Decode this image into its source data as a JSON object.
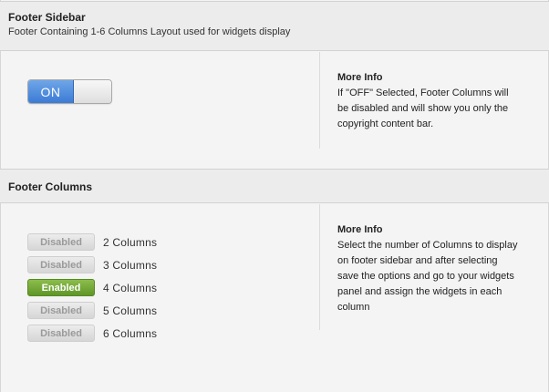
{
  "footer_sidebar": {
    "title": "Footer Sidebar",
    "subtitle": "Footer Containing 1-6 Columns Layout used for widgets display",
    "toggle_label": "ON",
    "info_title": "More Info",
    "info_text": "If \"OFF\" Selected, Footer Columns will be disabled and will show you only the copyright content bar."
  },
  "footer_columns": {
    "title": "Footer Columns",
    "options": [
      {
        "state": "Disabled",
        "label": "2 Columns"
      },
      {
        "state": "Disabled",
        "label": "3 Columns"
      },
      {
        "state": "Enabled",
        "label": "4 Columns"
      },
      {
        "state": "Disabled",
        "label": "5 Columns"
      },
      {
        "state": "Disabled",
        "label": "6 Columns"
      }
    ],
    "info_title": "More Info",
    "info_text": "Select the number of Columns to display on footer sidebar and after selecting save the options and go to your widgets panel and assign the widgets in each column"
  },
  "colors": {
    "toggle_on": "#3b7bd6",
    "enabled_green": "#6ea236",
    "disabled_gray": "#d6d6d6"
  }
}
